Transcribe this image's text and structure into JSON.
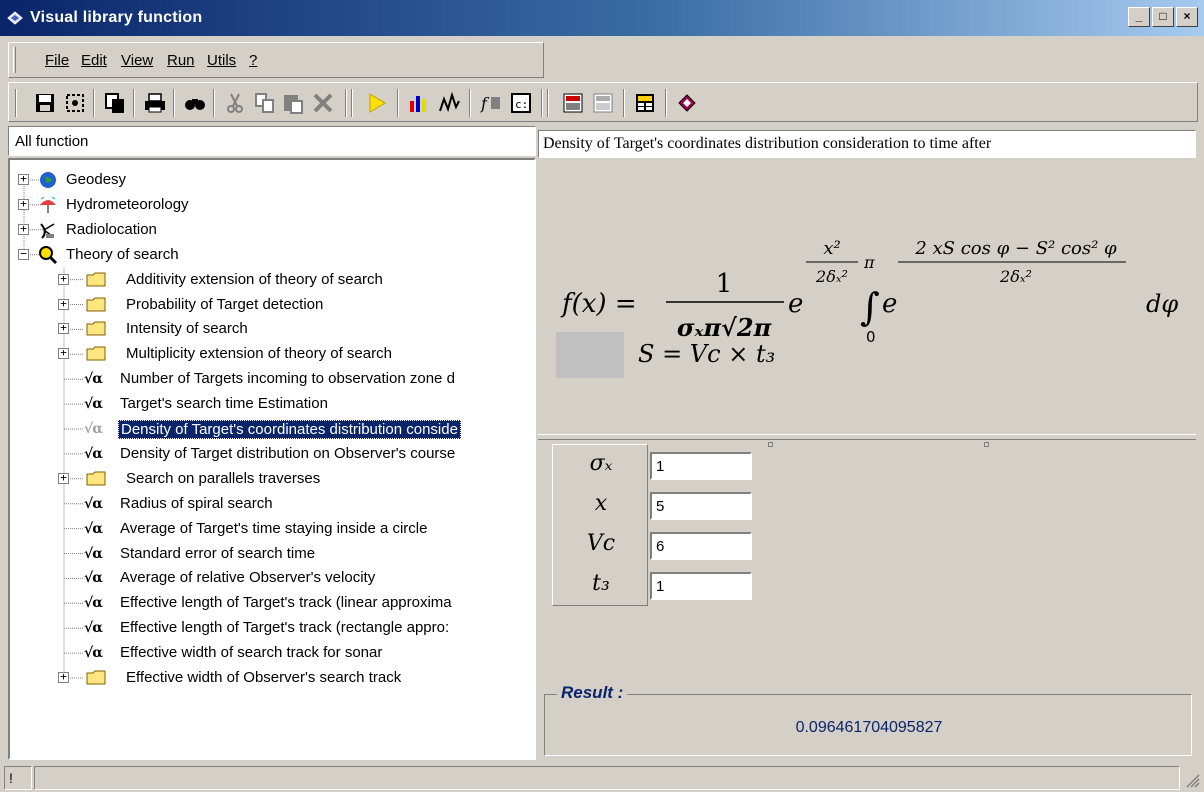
{
  "window": {
    "title": "Visual library function",
    "buttons": {
      "minimize": "_",
      "maximize": "□",
      "close": "×"
    }
  },
  "menu": {
    "items": [
      {
        "label": "File"
      },
      {
        "label": "Edit"
      },
      {
        "label": "View"
      },
      {
        "label": "Run"
      },
      {
        "label": "Utils"
      },
      {
        "label": "?"
      }
    ]
  },
  "toolbar": {
    "buttons": [
      "save-icon",
      "preview-icon",
      "copy-doc-icon",
      "print-icon",
      "find-icon",
      "cut-icon",
      "copy-icon",
      "paste-icon",
      "delete-icon",
      "run-icon",
      "chart-icon",
      "plot-icon",
      "function-icon",
      "code-icon",
      "calc-icon",
      "calc2-icon",
      "table-icon",
      "book-icon"
    ]
  },
  "tree": {
    "header": "All function",
    "nodes": [
      {
        "label": "Geodesy",
        "level": 0,
        "icon": "globe-icon",
        "expand": "+"
      },
      {
        "label": "Hydrometeorology",
        "level": 0,
        "icon": "umbrella-icon",
        "expand": "+"
      },
      {
        "label": "Radiolocation",
        "level": 0,
        "icon": "radar-icon",
        "expand": "+"
      },
      {
        "label": "Theory of search",
        "level": 0,
        "icon": "magnifier-icon",
        "expand": "-"
      },
      {
        "label": "Additivity extension of theory of search",
        "level": 1,
        "icon": "folder-icon",
        "expand": "+"
      },
      {
        "label": "Probability of Target detection",
        "level": 1,
        "icon": "folder-icon",
        "expand": "+"
      },
      {
        "label": "Intensity of search",
        "level": 1,
        "icon": "folder-icon",
        "expand": "+"
      },
      {
        "label": "Multiplicity extension of theory of search",
        "level": 1,
        "icon": "folder-icon",
        "expand": "+"
      },
      {
        "label": "Number of Targets incoming to observation zone d",
        "level": 1,
        "icon": "formula-icon",
        "expand": ""
      },
      {
        "label": "Target's search time Estimation",
        "level": 1,
        "icon": "formula-icon",
        "expand": ""
      },
      {
        "label": "Density of Target's coordinates distribution conside",
        "level": 1,
        "icon": "formula-icon",
        "expand": "",
        "selected": true
      },
      {
        "label": "Density of Target distribution on Observer's course",
        "level": 1,
        "icon": "formula-icon",
        "expand": ""
      },
      {
        "label": "Search on parallels traverses",
        "level": 1,
        "icon": "folder-icon",
        "expand": "+"
      },
      {
        "label": "Radius of spiral search",
        "level": 1,
        "icon": "formula-icon",
        "expand": ""
      },
      {
        "label": "Average of Target's time staying inside a circle",
        "level": 1,
        "icon": "formula-icon",
        "expand": ""
      },
      {
        "label": "Standard error of search time",
        "level": 1,
        "icon": "formula-icon",
        "expand": ""
      },
      {
        "label": "Average of relative Observer's velocity",
        "level": 1,
        "icon": "formula-icon",
        "expand": ""
      },
      {
        "label": "Effective length of Target's track (linear approxima",
        "level": 1,
        "icon": "formula-icon",
        "expand": ""
      },
      {
        "label": "Effective length of Target's track (rectangle appro:",
        "level": 1,
        "icon": "formula-icon",
        "expand": ""
      },
      {
        "label": "Effective width of search track for sonar",
        "level": 1,
        "icon": "formula-icon",
        "expand": ""
      },
      {
        "label": "Effective width of Observer's search track",
        "level": 1,
        "icon": "folder-icon",
        "expand": "+"
      }
    ],
    "formula_glyph": "√α"
  },
  "formula": {
    "title": "Density of Target's coordinates distribution consideration to time after",
    "lhs": "f(x) =",
    "frac_num": "1",
    "frac_den": "σₓπ√2π",
    "exp1_num": "x²",
    "exp1_den": "2δₓ²",
    "int_upper": "π",
    "int_lower": "0",
    "exp2_num": "2 xS cos φ − S² cos² φ",
    "exp2_den": "2δₓ²",
    "base": "e",
    "dphi": "dφ",
    "secondary": "S = Vc × t₃"
  },
  "params": [
    {
      "symbol": "σₓ",
      "value": "1"
    },
    {
      "symbol": "x",
      "value": "5"
    },
    {
      "symbol": "Vc",
      "value": "6"
    },
    {
      "symbol": "t₃",
      "value": "1"
    }
  ],
  "result": {
    "label": "Result :",
    "value": "0.096461704095827"
  },
  "status": {
    "panel1": "!",
    "panel2": ""
  }
}
